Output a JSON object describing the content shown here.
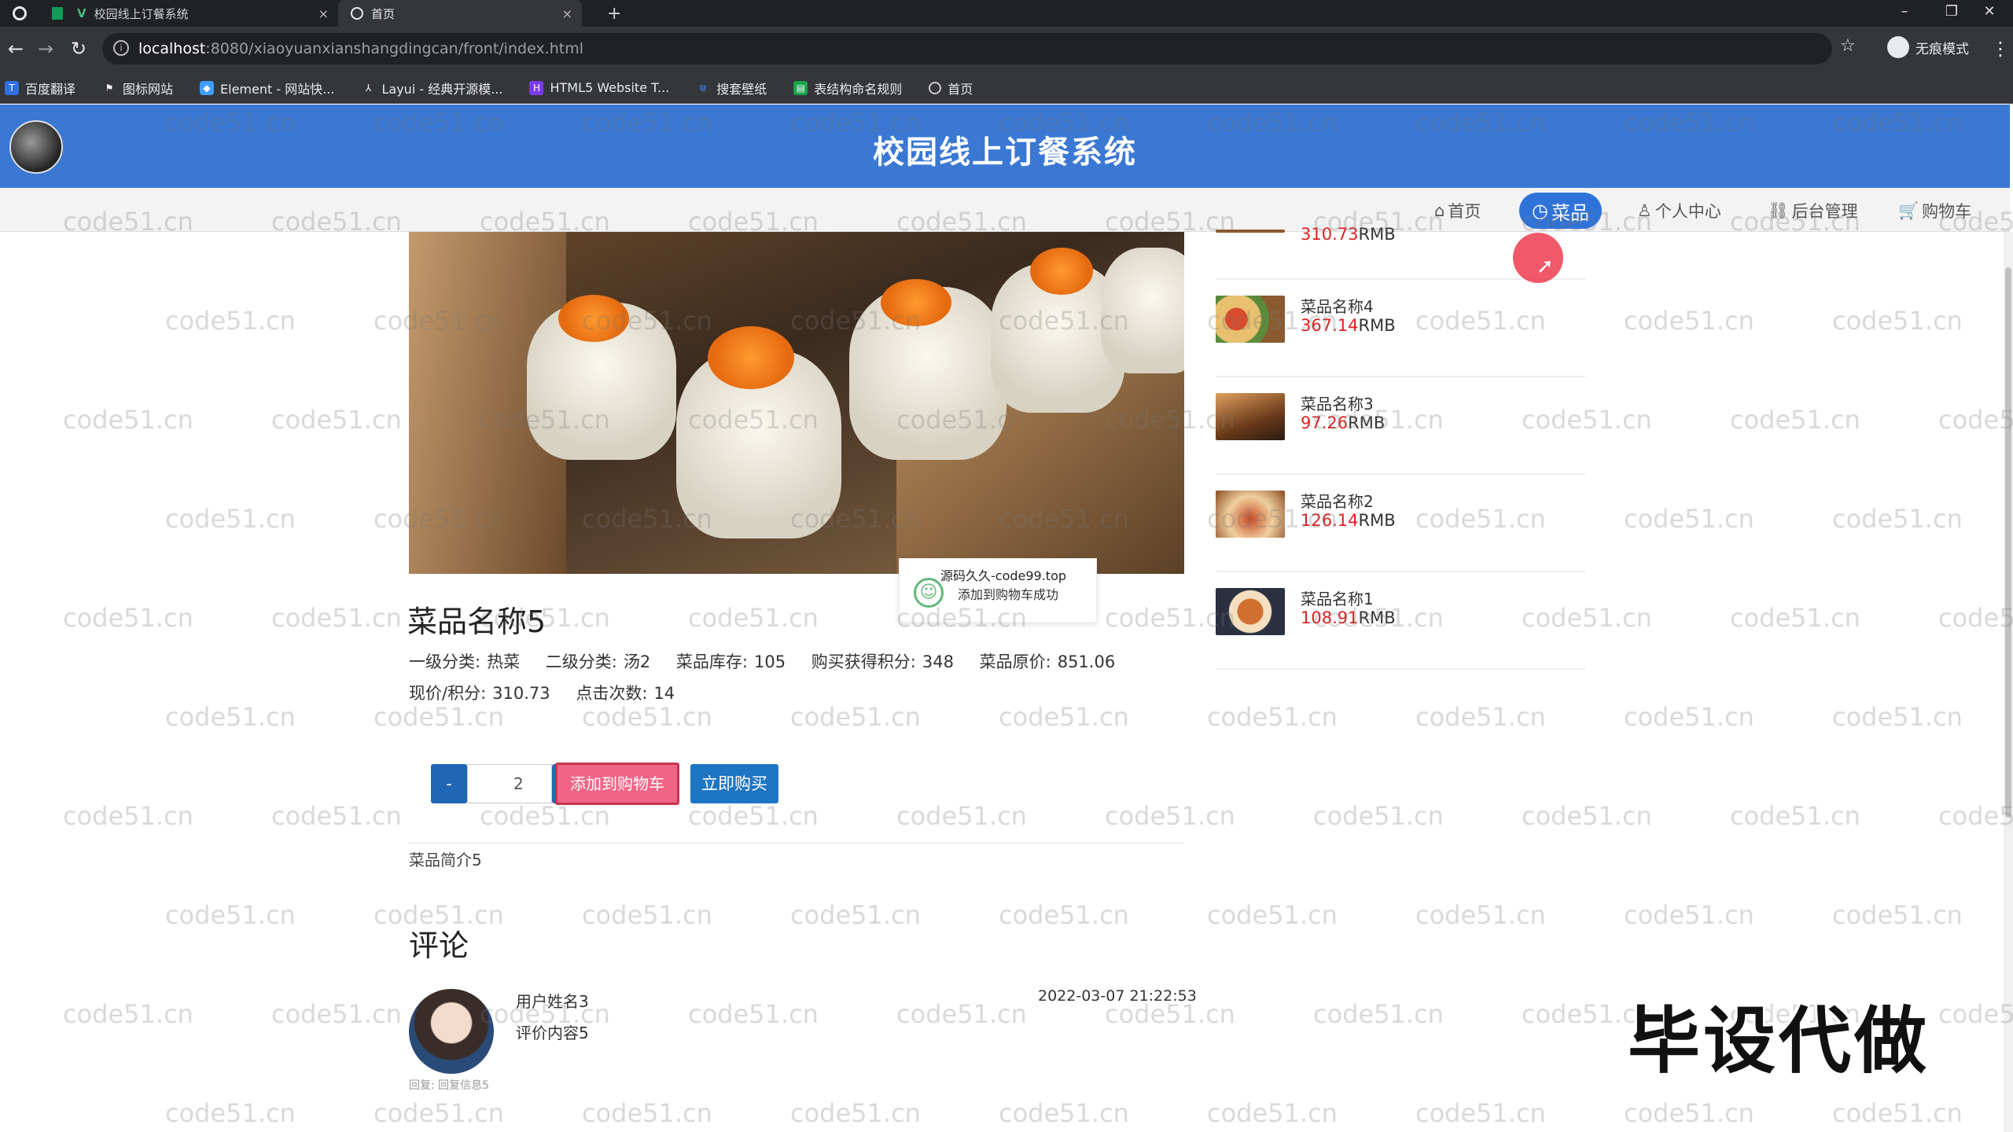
{
  "browser": {
    "tabs": [
      {
        "title": "校园线上订餐系统",
        "active": false
      },
      {
        "title": "首页",
        "active": true
      }
    ],
    "new_tab_symbol": "+",
    "url_host": "localhost",
    "url_path": ":8080/xiaoyuanxianshangdingcan/front/index.html",
    "incognito_label": "无痕模式",
    "bookmarks": [
      {
        "label": "百度翻译",
        "icon": "translate-icon",
        "color": "#2f6fde"
      },
      {
        "label": "图标网站",
        "icon": "flag-icon",
        "color": "#ffffff"
      },
      {
        "label": "Element - 网站快...",
        "icon": "element-icon",
        "color": "#409eff"
      },
      {
        "label": "Layui - 经典开源模...",
        "icon": "layui-icon",
        "color": "#888888"
      },
      {
        "label": "HTML5 Website T...",
        "icon": "html5-icon",
        "color": "#7c3aed"
      },
      {
        "label": "搜套壁纸",
        "icon": "wallpaper-icon",
        "color": "#3b82f6"
      },
      {
        "label": "表结构命名规则",
        "icon": "table-icon",
        "color": "#16a34a"
      },
      {
        "label": "首页",
        "icon": "globe-icon",
        "color": "#9aa0a6"
      }
    ]
  },
  "site": {
    "title": "校园线上订餐系统",
    "nav": [
      {
        "label": "首页",
        "icon": "home-icon",
        "active": false
      },
      {
        "label": "菜品",
        "icon": "clock-icon",
        "active": true
      },
      {
        "label": "个人中心",
        "icon": "user-icon",
        "active": false
      },
      {
        "label": "后台管理",
        "icon": "link-icon",
        "active": false
      },
      {
        "label": "购物车",
        "icon": "cart-icon",
        "active": false
      }
    ],
    "accent": "#3a78d3"
  },
  "product": {
    "name": "菜品名称5",
    "meta_line1": [
      {
        "label": "一级分类:",
        "value": "热菜"
      },
      {
        "label": "二级分类:",
        "value": "汤2"
      },
      {
        "label": "菜品库存:",
        "value": "105"
      },
      {
        "label": "购买获得积分:",
        "value": "348"
      },
      {
        "label": "菜品原价:",
        "value": "851.06"
      }
    ],
    "meta_line2": [
      {
        "label": "现价/积分:",
        "value": "310.73"
      },
      {
        "label": "点击次数:",
        "value": "14"
      }
    ],
    "quantity": "2",
    "minus_label": "-",
    "plus_label": "+",
    "add_to_cart_label": "添加到购物车",
    "buy_now_label": "立即购买",
    "intro": "菜品简介5"
  },
  "toast": {
    "line1": "源码久久-code99.top",
    "line2": "添加到购物车成功"
  },
  "comments": {
    "title": "评论",
    "items": [
      {
        "user": "用户姓名3",
        "content": "评价内容5",
        "time": "2022-03-07 21:22:53",
        "reply": "回复: 回复信息5"
      }
    ]
  },
  "sidebar": {
    "items": [
      {
        "name": "",
        "price": "310.73",
        "unit": "RMB"
      },
      {
        "name": "菜品名称4",
        "price": "367.14",
        "unit": "RMB"
      },
      {
        "name": "菜品名称3",
        "price": "97.26",
        "unit": "RMB"
      },
      {
        "name": "菜品名称2",
        "price": "126.14",
        "unit": "RMB"
      },
      {
        "name": "菜品名称1",
        "price": "108.91",
        "unit": "RMB"
      }
    ]
  },
  "promo_text": "毕设代做",
  "watermark_text": "code51.cn"
}
